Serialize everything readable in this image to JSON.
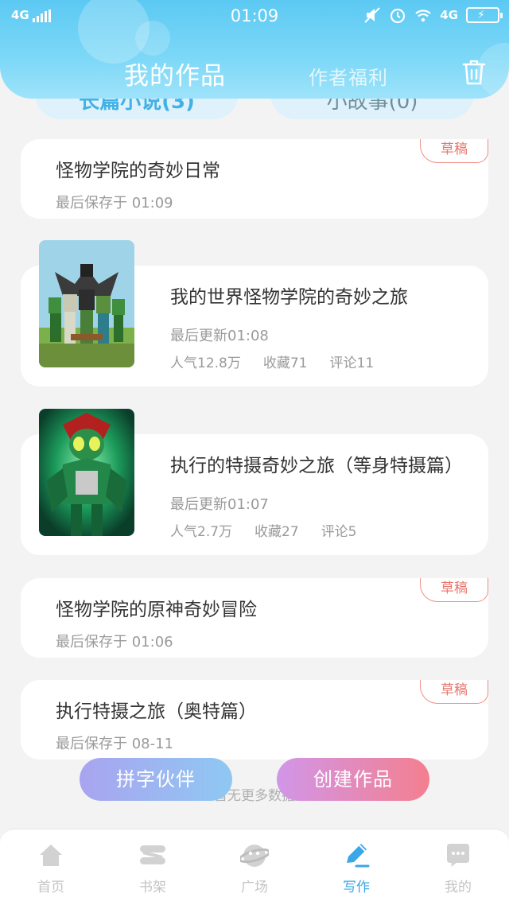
{
  "status_bar": {
    "network_left": "4G",
    "time": "01:09",
    "network_right": "4G"
  },
  "header": {
    "tab_mine": "我的作品",
    "tab_welfare": "作者福利",
    "category_tabs": [
      "长篇小说(3)",
      "小故事(0)"
    ]
  },
  "works": [
    {
      "kind": "draft",
      "title": "怪物学院的奇妙日常",
      "time": "最后保存于 01:09",
      "badge": "草稿"
    },
    {
      "kind": "book",
      "title": "我的世界怪物学院的奇妙之旅",
      "updated": "最后更新01:08",
      "popularity": "人气12.8万",
      "favorites": "收藏71",
      "comments": "评论11",
      "cover": "minecraft-cover"
    },
    {
      "kind": "book",
      "title": "执行的特摄奇妙之旅（等身特摄篇）",
      "updated": "最后更新01:07",
      "popularity": "人气2.7万",
      "favorites": "收藏27",
      "comments": "评论5",
      "cover": "kamen-rider-cover"
    },
    {
      "kind": "draft",
      "title": "怪物学院的原神奇妙冒险",
      "time": "最后保存于 01:06",
      "badge": "草稿"
    },
    {
      "kind": "draft",
      "title": "执行特摄之旅（奥特篇）",
      "time": "最后保存于 08-11",
      "badge": "草稿"
    }
  ],
  "footer_note": "暂无更多数据",
  "buttons": {
    "partner": "拼字伙伴",
    "create": "创建作品"
  },
  "tabbar": [
    {
      "label": "首页",
      "icon": "home-icon"
    },
    {
      "label": "书架",
      "icon": "bookshelf-icon"
    },
    {
      "label": "广场",
      "icon": "square-icon"
    },
    {
      "label": "写作",
      "icon": "write-icon",
      "active": true
    },
    {
      "label": "我的",
      "icon": "profile-icon"
    }
  ],
  "colors": {
    "header": "#5cc9f3",
    "accent": "#3aa7e8",
    "draft_badge": "#e8766c"
  }
}
